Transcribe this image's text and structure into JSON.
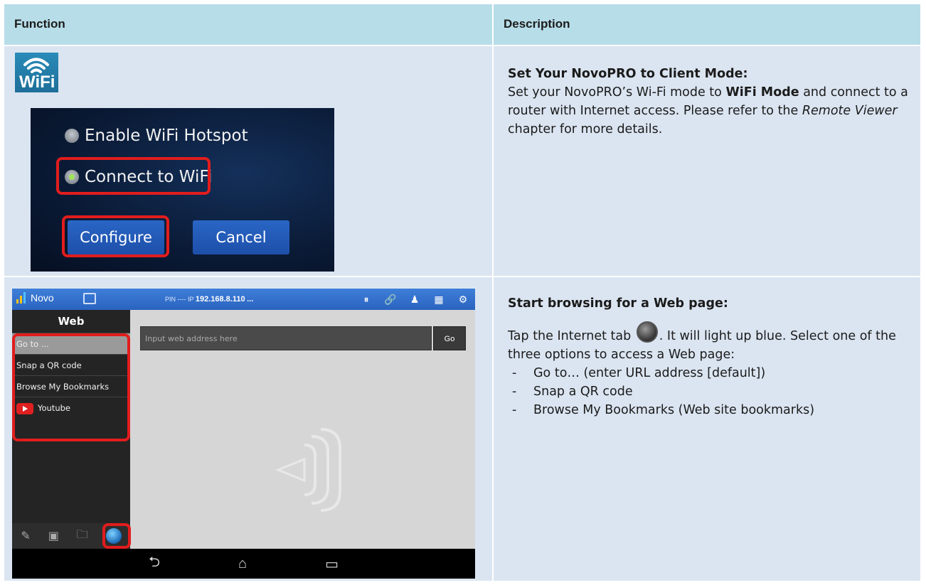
{
  "header": {
    "function_label": "Function",
    "description_label": "Description"
  },
  "row1": {
    "wifi_icon_text": "WiFi",
    "dialog": {
      "option_hotspot": "Enable WiFi Hotspot",
      "option_connect": "Connect to WiFi",
      "configure_label": "Configure",
      "cancel_label": "Cancel"
    },
    "title": "Set Your NovoPRO to Client Mode:",
    "text_1": "Set your NovoPRO’s Wi-Fi mode to ",
    "text_bold": "WiFi Mode",
    "text_2": " and connect to a router with Internet access. Please refer to the ",
    "text_italic": "Remote Viewer",
    "text_3": " chapter for more details."
  },
  "row2": {
    "app": {
      "logo_text": "Novo",
      "pin_text": "PIN ---- IP ",
      "ip_text": "192.168.8.110",
      "ip_more": "...",
      "sidebar_title": "Web",
      "items": [
        "Go to ...",
        "Snap a QR code",
        "Browse My Bookmarks",
        "Youtube"
      ],
      "url_placeholder": "Input web address here",
      "go_label": "Go"
    },
    "title": "Start browsing for a Web page:",
    "text_1": "Tap the Internet tab ",
    "text_2": ". It will light up blue. Select one of the three options to access a Web page:",
    "options": [
      "Go to… (enter URL address [default])",
      "Snap a QR code",
      "Browse My Bookmarks (Web site bookmarks)"
    ]
  },
  "colors": {
    "header_bg": "#b7dde8",
    "row_bg": "#dbe5f1",
    "highlight": "#e11d1d",
    "app_blue": "#2a63c0"
  }
}
